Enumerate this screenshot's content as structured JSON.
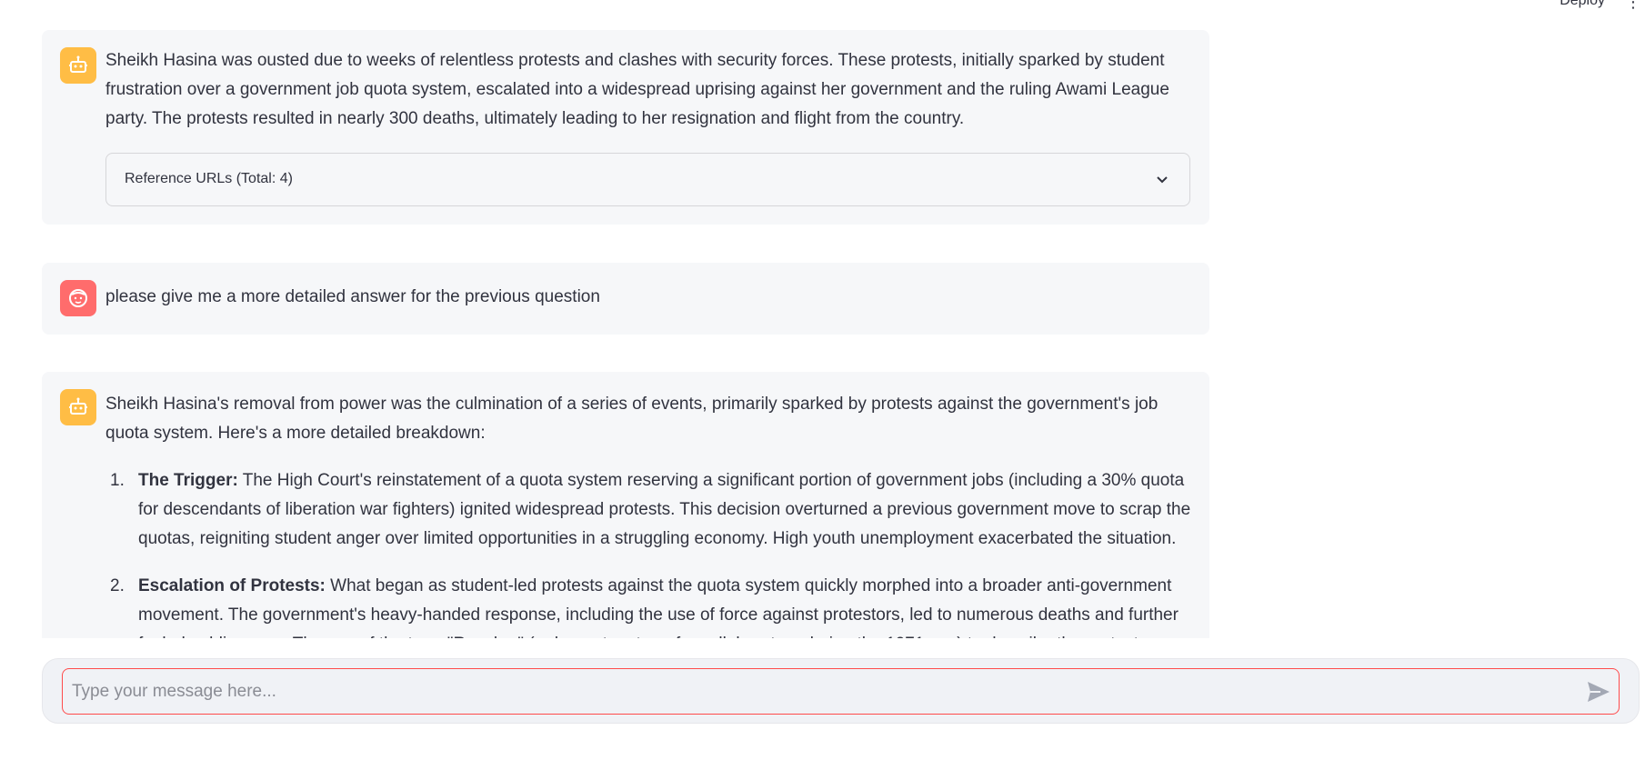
{
  "header": {
    "deploy_label": "Deploy",
    "menu_icon": "more-vertical-icon"
  },
  "messages": [
    {
      "role": "assistant",
      "avatar_icon": "robot-icon",
      "text": "Sheikh Hasina was ousted due to weeks of relentless protests and clashes with security forces. These protests, initially sparked by student frustration over a government job quota system, escalated into a widespread uprising against her government and the ruling Awami League party. The protests resulted in nearly 300 deaths, ultimately leading to her resignation and flight from the country.",
      "expander_label": "Reference URLs (Total: 4)"
    },
    {
      "role": "user",
      "avatar_icon": "user-face-icon",
      "text": "please give me a more detailed answer for the previous question"
    },
    {
      "role": "assistant",
      "avatar_icon": "robot-icon",
      "intro": "Sheikh Hasina's removal from power was the culmination of a series of events, primarily sparked by protests against the government's job quota system. Here's a more detailed breakdown:",
      "points": [
        {
          "number": "1.",
          "title": "The Trigger:",
          "body": " The High Court's reinstatement of a quota system reserving a significant portion of government jobs (including a 30% quota for descendants of liberation war fighters) ignited widespread protests. This decision overturned a previous government move to scrap the quotas, reigniting student anger over limited opportunities in a struggling economy. High youth unemployment exacerbated the situation."
        },
        {
          "number": "2.",
          "title": "Escalation of Protests:",
          "body": " What began as student-led protests against the quota system quickly morphed into a broader anti-government movement. The government's heavy-handed response, including the use of force against protestors, led to numerous deaths and further fueled public anger. The use of the term \"Razakar\" (a derogatory term for collaborators during the 1971 war) to describe the protestors"
        }
      ]
    }
  ],
  "chat_input": {
    "placeholder": "Type your message here...",
    "value": "",
    "send_icon": "send-icon"
  },
  "colors": {
    "bot_avatar": "#ffbd45",
    "user_avatar": "#ff6c6c",
    "message_bg": "#f6f7f9",
    "input_focus_border": "#ff4b4b"
  }
}
